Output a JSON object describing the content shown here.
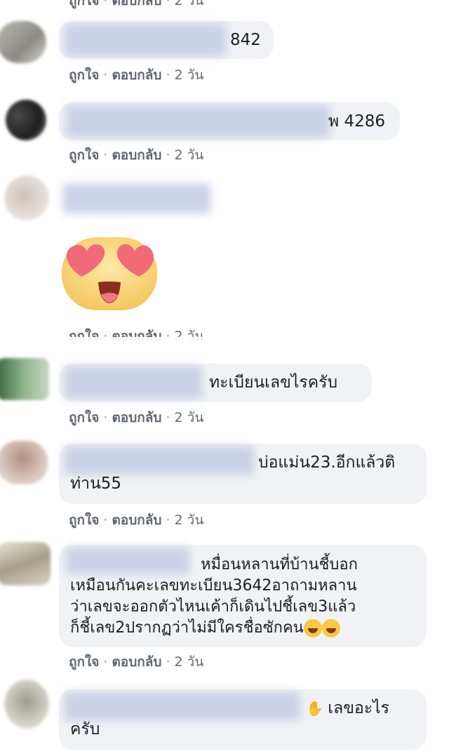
{
  "meta": {
    "like_label": "ถูกใจ",
    "reply_label": "ตอบกลับ",
    "time_label": "2 วัน",
    "separator": "·"
  },
  "comments": [
    {
      "text": "842"
    },
    {
      "text": "พ 4286"
    },
    {
      "text": ""
    },
    {
      "text": "ทะเบียนเลขไรครับ"
    },
    {
      "text": "บ่อแม่น23.อีกแล้วติ\nท่าน55"
    },
    {
      "text": "หมื่อนหลานที่บ้านชี้บอก\nเหมือนกันคะเลขทะเบียน3642อาถามหลาน\nว่าเลขจะออกตัวไหนเค้าก็เดินไปชี้เลข3แล้ว\nก็ชี้เลข2ปรากฏว่าไม่มีใครชื่อซักคน"
    },
    {
      "text": "เลขอะไร\nครับ"
    }
  ],
  "sticker": {
    "name": "heart-eyes-emoji"
  },
  "colors": {
    "bubble": "#f0f2f5",
    "meta_text": "#65676b",
    "blur_name": "#c9cfe6"
  }
}
